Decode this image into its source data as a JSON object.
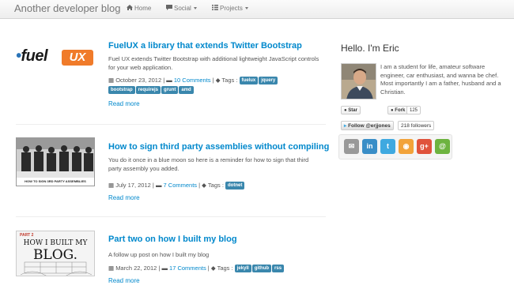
{
  "navbar": {
    "brand": "Another developer blog",
    "items": [
      {
        "label": "Home",
        "icon": "home-icon"
      },
      {
        "label": "Social",
        "icon": "comment-icon"
      },
      {
        "label": "Projects",
        "icon": "list-icon"
      }
    ]
  },
  "posts": [
    {
      "title": "FuelUX a library that extends Twitter Bootstrap",
      "thumb_logo": {
        "prefix": "fuel",
        "suffix": "UX"
      },
      "excerpt": "Fuel UX extends Twitter Bootstrap with additional lightweight JavaScript controls for your web application.",
      "date": "October 23, 2012",
      "comments": "10 Comments",
      "tags_label": "Tags :",
      "tags": [
        "fuelux",
        "jquery",
        "bootstrap",
        "requirejs",
        "grunt",
        "amd"
      ],
      "read_more": "Read more"
    },
    {
      "title": "How to sign third party assemblies without compiling",
      "thumb_caption": "HOW TO SIGN 3RD PARTY ASSEMBLIES",
      "excerpt": "You do it once in a blue moon so here is a reminder for how to sign that third party assembly you added.",
      "date": "July 17, 2012",
      "comments": "7 Comments",
      "tags_label": "Tags :",
      "tags": [
        "dotnet"
      ],
      "read_more": "Read more"
    },
    {
      "title": "Part two on how I built my blog",
      "thumb_text": {
        "part": "PART 2",
        "line1": "HOW I BUILT MY",
        "line2": "BLOG."
      },
      "excerpt": "A follow up post on how I built my blog",
      "date": "March 22, 2012",
      "comments": "17 Comments",
      "tags_label": "Tags :",
      "tags": [
        "jekyll",
        "github",
        "rss"
      ],
      "read_more": "Read more"
    }
  ],
  "sidebar": {
    "title": "Hello. I'm Eric",
    "bio": "I am a student for life, amateur software engineer, car enthusiast, and wanna be chef. Most importantly I am a father, husband and a Christian.",
    "github": {
      "star_label": "Star",
      "fork_label": "Fork",
      "fork_count": "125"
    },
    "twitter": {
      "follow_label": "Follow @erjjones",
      "followers": "218 followers"
    },
    "social_icons": [
      {
        "name": "email-icon",
        "glyph": "✉",
        "color": "#999999"
      },
      {
        "name": "linkedin-icon",
        "glyph": "in",
        "color": "#3a8ec7"
      },
      {
        "name": "twitter-icon",
        "glyph": "t",
        "color": "#3fa9e0"
      },
      {
        "name": "rss-icon",
        "glyph": "◉",
        "color": "#f2a33a"
      },
      {
        "name": "googleplus-icon",
        "glyph": "g+",
        "color": "#e0533c"
      },
      {
        "name": "at-icon",
        "glyph": "@",
        "color": "#6db33f"
      }
    ]
  }
}
